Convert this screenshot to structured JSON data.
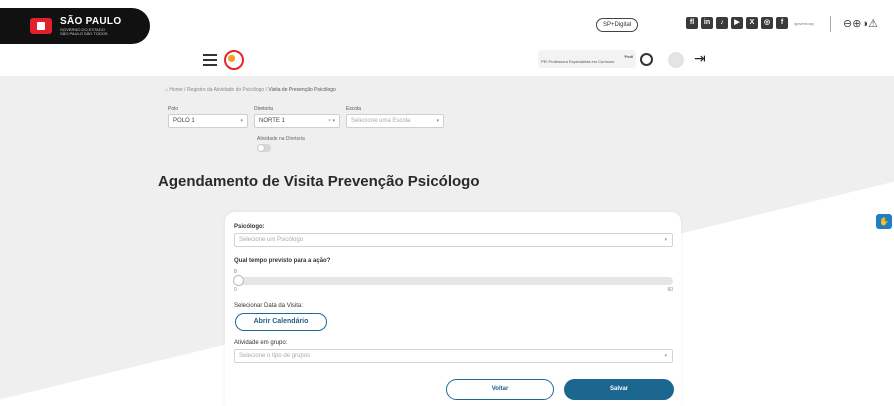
{
  "header": {
    "logo": {
      "line1": "SÃO PAULO",
      "line2": "GOVERNO DO ESTADO",
      "line3": "SÃO PAULO SÃO TODOS"
    },
    "sp_digital": "SP+Digital",
    "social_icons": [
      "flickr-icon",
      "linkedin-icon",
      "tiktok-icon",
      "youtube-icon",
      "x-icon",
      "instagram-icon",
      "facebook-icon"
    ],
    "social_handle": "/governosp",
    "accessibility_glyphs": "⊖⊕◑⚠"
  },
  "subheader": {
    "profile_name": "Pedi",
    "profile_role": "PEI Professora Especialista em Currículo"
  },
  "breadcrumb": {
    "home": "Home",
    "sep": "/",
    "mid": "Registro da Atividade do Psicólogo",
    "current": "Visita de Prevenção Psicólogo"
  },
  "filters": {
    "polo": {
      "label": "Polo",
      "value": "POLO 1"
    },
    "diretoria": {
      "label": "Diretoria",
      "value": "NORTE 1",
      "controls": "× ▾"
    },
    "escola": {
      "label": "Escola",
      "placeholder": "Selecione uma Escola"
    },
    "atividade_diretoria": {
      "label": "Atividade na Diretoria"
    }
  },
  "page": {
    "title": "Agendamento de Visita Prevenção Psicólogo"
  },
  "form": {
    "psicologo": {
      "label": "Psicólogo:",
      "placeholder": "Selecione um Psicólogo"
    },
    "tempo": {
      "label": "Qual tempo previsto para a ação?",
      "current": "0",
      "min": "0",
      "max": "60",
      "value_fraction": 0
    },
    "data_visita": {
      "label": "Selecionar Data da Visita:",
      "button": "Abrir Calendário"
    },
    "grupo": {
      "label": "Atividade em grupo:",
      "placeholder": "Selecione o tipo de grupos"
    },
    "voltar": "Voltar",
    "salvar": "Salvar"
  },
  "side_button": {
    "icon": "accessibility-hand-icon",
    "glyph": "✋"
  }
}
